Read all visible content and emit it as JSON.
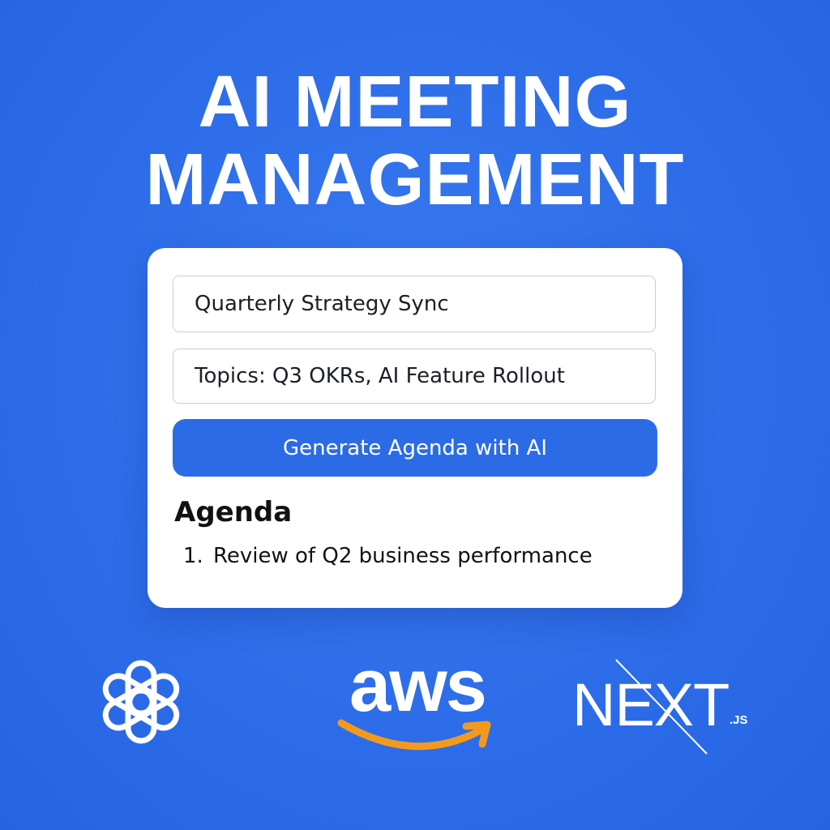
{
  "headline": {
    "line1": "AI MEETING",
    "line2": "MANAGEMENT"
  },
  "form": {
    "meeting_title_value": "Quarterly Strategy Sync",
    "topics_value": "Topics: Q3 OKRs, AI Feature Rollout",
    "generate_button_label": "Generate Agenda with AI"
  },
  "agenda": {
    "heading": "Agenda",
    "items": [
      {
        "number": "1.",
        "text": "Review of Q2 business performance"
      }
    ]
  },
  "logos": {
    "aws_text": "aws",
    "next_text": "NEXT",
    "next_suffix": ".JS",
    "icons": [
      "openai-logo-icon",
      "aws-logo-icon",
      "nextjs-logo-icon"
    ]
  },
  "colors": {
    "background": "#2f6fea",
    "button": "#2b6ce6",
    "aws_smile": "#f39a1d"
  }
}
